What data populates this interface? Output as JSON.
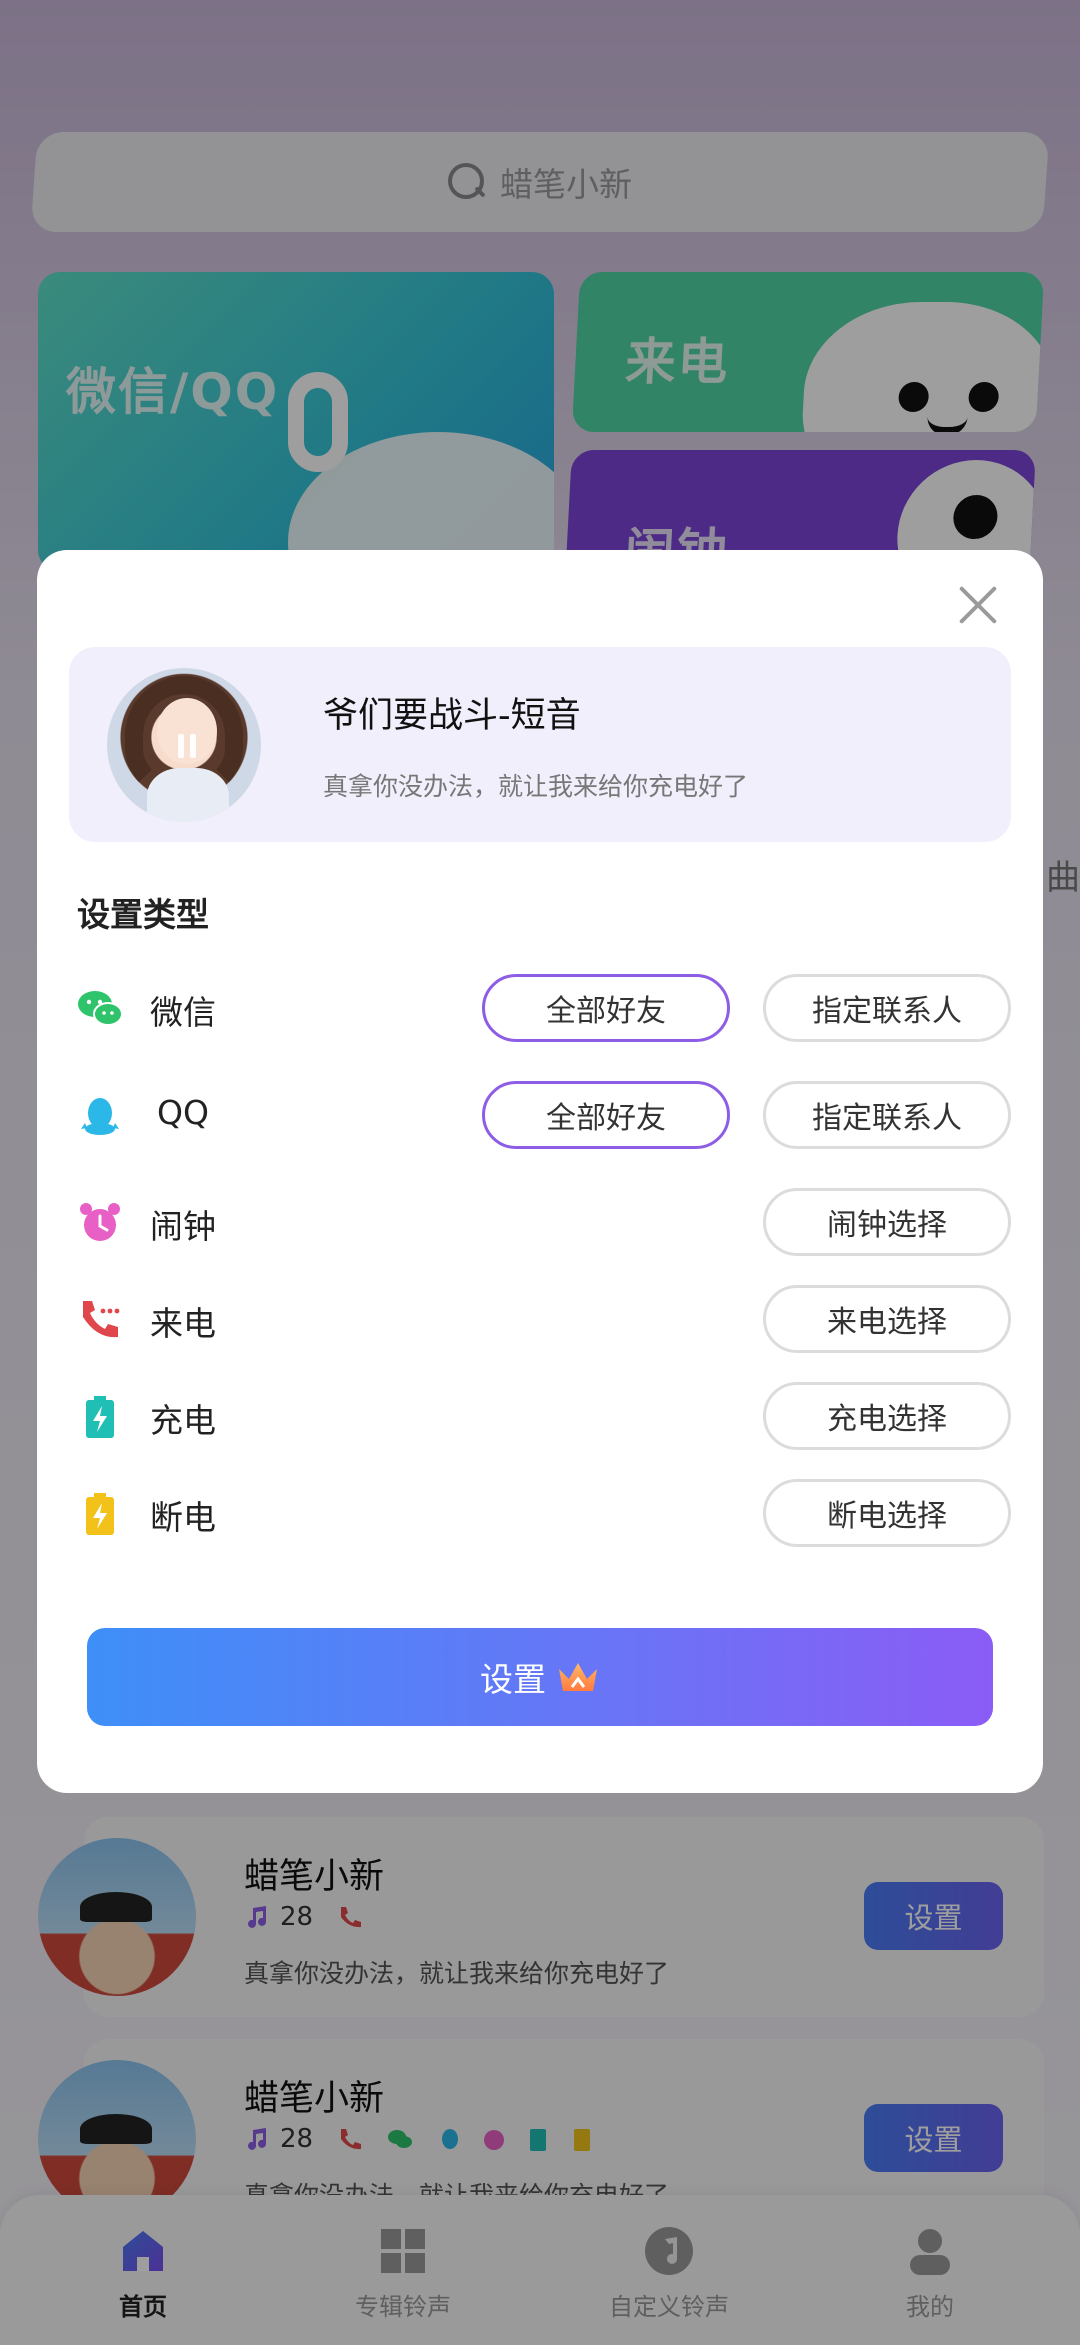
{
  "search": {
    "placeholder_text": "蜡笔小新"
  },
  "category_cards": [
    {
      "label": "微信/QQ"
    },
    {
      "label": "来电"
    },
    {
      "label": "闹钟"
    }
  ],
  "side_text": "曲",
  "modal": {
    "song": {
      "title": "爷们要战斗-短音",
      "description": "真拿你没办法，就让我来给你充电好了"
    },
    "section_title": "设置类型",
    "rows": [
      {
        "label": "微信",
        "icon": "wechat-icon",
        "options": [
          "全部好友",
          "指定联系人"
        ],
        "selected": "全部好友"
      },
      {
        "label": "QQ",
        "icon": "qq-icon",
        "options": [
          "全部好友",
          "指定联系人"
        ],
        "selected": "全部好友"
      },
      {
        "label": "闹钟",
        "icon": "alarm-clock-icon",
        "options": [
          "闹钟选择"
        ]
      },
      {
        "label": "来电",
        "icon": "phone-call-icon",
        "options": [
          "来电选择"
        ]
      },
      {
        "label": "充电",
        "icon": "battery-charging-icon",
        "options": [
          "充电选择"
        ]
      },
      {
        "label": "断电",
        "icon": "battery-unplug-icon",
        "options": [
          "断电选择"
        ]
      }
    ],
    "confirm_label": "设置",
    "confirm_icon": "crown-icon"
  },
  "list": [
    {
      "title": "蜡笔小新",
      "plays": "28",
      "description": "真拿你没办法，就让我来给你充电好了",
      "button": "设置"
    },
    {
      "title": "蜡笔小新",
      "plays": "28",
      "description": "真拿你没办法，就让我来给你充电好了",
      "button": "设置"
    }
  ],
  "tabs": [
    {
      "label": "首页",
      "icon": "home-icon",
      "active": true
    },
    {
      "label": "专辑铃声",
      "icon": "album-grid-icon",
      "active": false
    },
    {
      "label": "自定义铃声",
      "icon": "custom-ringtone-icon",
      "active": false
    },
    {
      "label": "我的",
      "icon": "profile-icon",
      "active": false
    }
  ],
  "colors": {
    "accent_purple": "#8d5de6",
    "button_gradient_start": "#3e8ff8",
    "button_gradient_end": "#8b5cf6",
    "wechat_green": "#2fc36b",
    "qq_cyan": "#2bb8e8"
  }
}
